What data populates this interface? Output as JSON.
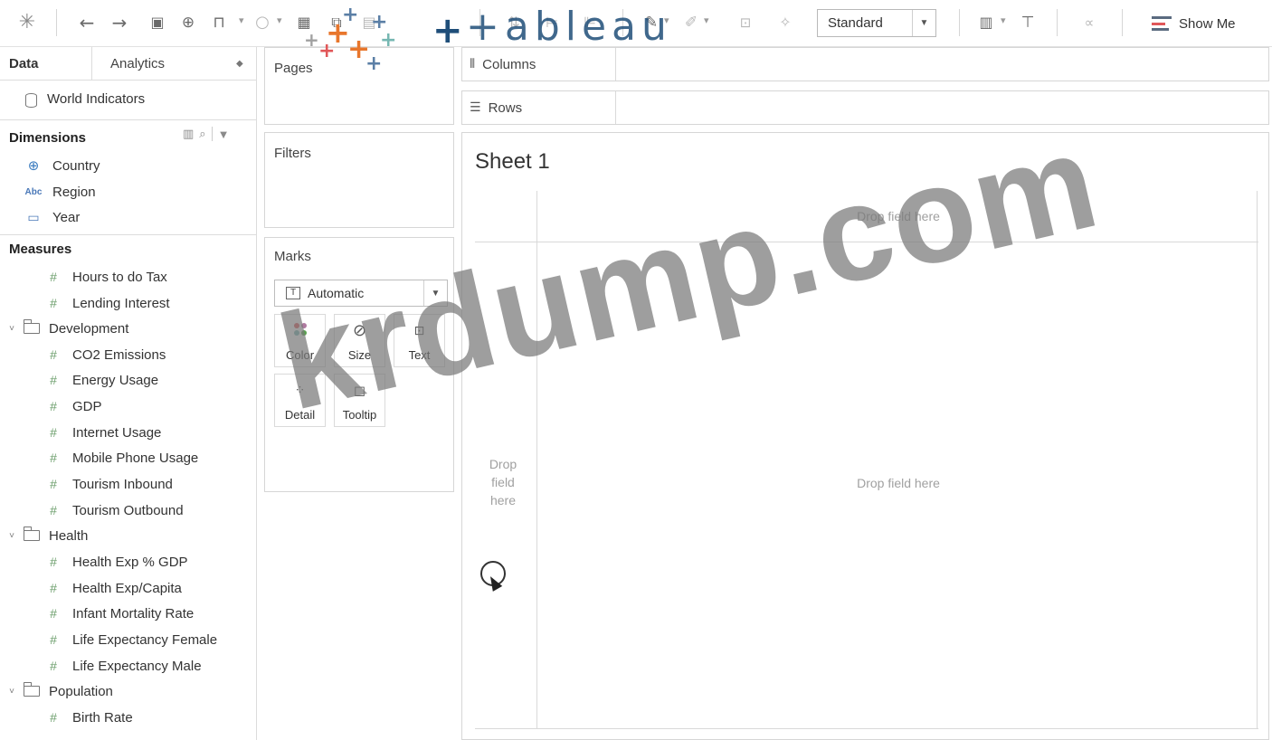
{
  "toolbar": {
    "icons": [
      "tableau-logo-icon",
      "undo-icon",
      "redo-icon",
      "save-icon",
      "new-data-source-icon",
      "pause-updates-icon",
      "run-update-icon",
      "new-worksheet-icon",
      "duplicate-sheet-icon",
      "clear-sheet-icon",
      "swap-icon",
      "sort-ascending-icon",
      "sort-descending-icon",
      "highlight-icon",
      "group-icon",
      "labels-icon",
      "fix-axes-icon",
      "cards-icon",
      "presentation-icon",
      "share-icon"
    ],
    "fit_select": {
      "value": "Standard"
    },
    "show_me_label": "Show Me",
    "logo_text": "+ableau"
  },
  "data_pane": {
    "tab_data": "Data",
    "tab_analytics": "Analytics",
    "data_source": "World Indicators",
    "dimensions_header": "Dimensions",
    "dimensions": [
      {
        "label": "Country",
        "icon": "globe-icon"
      },
      {
        "label": "Region",
        "icon": "abc-icon"
      },
      {
        "label": "Year",
        "icon": "calendar-icon"
      }
    ],
    "measures_header": "Measures",
    "measures_top": [
      "Hours to do Tax",
      "Lending Interest"
    ],
    "folders": [
      {
        "name": "Development",
        "items": [
          "CO2 Emissions",
          "Energy Usage",
          "GDP",
          "Internet Usage",
          "Mobile Phone Usage",
          "Tourism Inbound",
          "Tourism Outbound"
        ]
      },
      {
        "name": "Health",
        "items": [
          "Health Exp % GDP",
          "Health Exp/Capita",
          "Infant Mortality Rate",
          "Life Expectancy Female",
          "Life Expectancy Male"
        ]
      },
      {
        "name": "Population",
        "items": [
          "Birth Rate"
        ]
      }
    ]
  },
  "cards": {
    "pages_title": "Pages",
    "filters_title": "Filters",
    "marks_title": "Marks",
    "mark_type": "Automatic",
    "mark_buttons": [
      "Color",
      "Size",
      "Text",
      "Detail",
      "Tooltip"
    ]
  },
  "shelves": {
    "columns_label": "Columns",
    "rows_label": "Rows"
  },
  "view": {
    "sheet_title": "Sheet 1",
    "drop_top": "Drop field here",
    "drop_left": "Drop field here",
    "drop_main": "Drop field here"
  },
  "watermark": "krdump.com",
  "colors": {
    "accent_blue": "#1f4e79",
    "logo_orange": "#e8762c",
    "show_me_red": "#e15759"
  }
}
